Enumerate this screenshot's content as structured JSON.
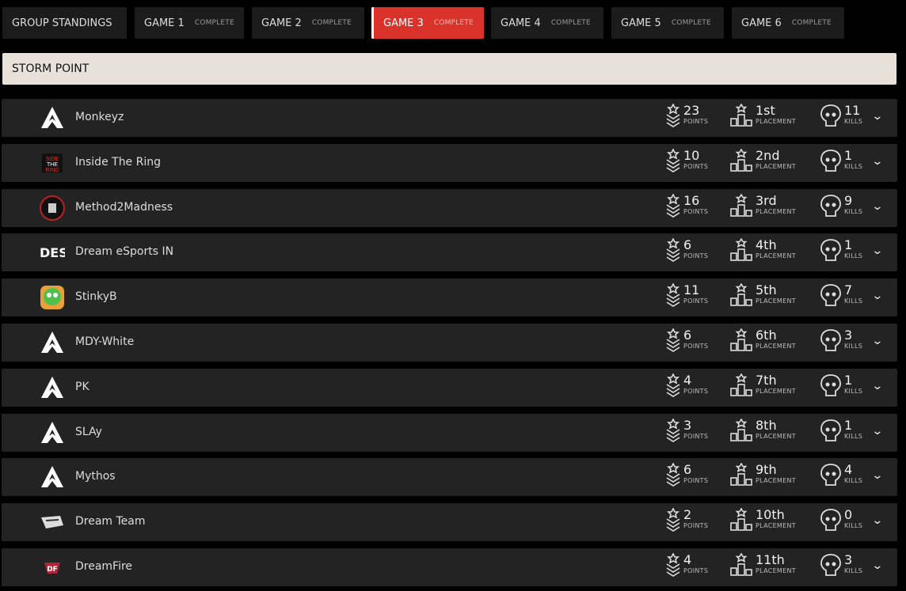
{
  "tabs": [
    {
      "label": "GROUP STANDINGS",
      "status": ""
    },
    {
      "label": "GAME 1",
      "status": "COMPLETE"
    },
    {
      "label": "GAME 2",
      "status": "COMPLETE"
    },
    {
      "label": "GAME 3",
      "status": "COMPLETE",
      "active": true
    },
    {
      "label": "GAME 4",
      "status": "COMPLETE"
    },
    {
      "label": "GAME 5",
      "status": "COMPLETE"
    },
    {
      "label": "GAME 6",
      "status": "COMPLETE"
    }
  ],
  "map_name": "STORM POINT",
  "labels": {
    "points": "POINTS",
    "placement": "PLACEMENT",
    "kills": "KILLS"
  },
  "colors": {
    "accent": "#d9322a",
    "banner": "#e7e1d9",
    "row": "#232323"
  },
  "teams": [
    {
      "name": "Monkeyz",
      "logo": "apex-logo",
      "points": "23",
      "placement": "1st",
      "kills": "11"
    },
    {
      "name": "Inside The Ring",
      "logo": "inside-the-ring-logo",
      "points": "10",
      "placement": "2nd",
      "kills": "1"
    },
    {
      "name": "Method2Madness",
      "logo": "method2madness-logo",
      "points": "16",
      "placement": "3rd",
      "kills": "9"
    },
    {
      "name": "Dream eSports IN",
      "logo": "desi-logo",
      "points": "6",
      "placement": "4th",
      "kills": "1"
    },
    {
      "name": "StinkyB",
      "logo": "stinkyb-logo",
      "points": "11",
      "placement": "5th",
      "kills": "7"
    },
    {
      "name": "MDY-White",
      "logo": "apex-logo",
      "points": "6",
      "placement": "6th",
      "kills": "3"
    },
    {
      "name": "PK",
      "logo": "apex-logo",
      "points": "4",
      "placement": "7th",
      "kills": "1"
    },
    {
      "name": "SLAy",
      "logo": "apex-logo",
      "points": "3",
      "placement": "8th",
      "kills": "1"
    },
    {
      "name": "Mythos",
      "logo": "apex-logo",
      "points": "6",
      "placement": "9th",
      "kills": "4"
    },
    {
      "name": "Dream Team",
      "logo": "dream-team-logo",
      "points": "2",
      "placement": "10th",
      "kills": "0"
    },
    {
      "name": "DreamFire",
      "logo": "dreamfire-logo",
      "points": "4",
      "placement": "11th",
      "kills": "3"
    }
  ]
}
